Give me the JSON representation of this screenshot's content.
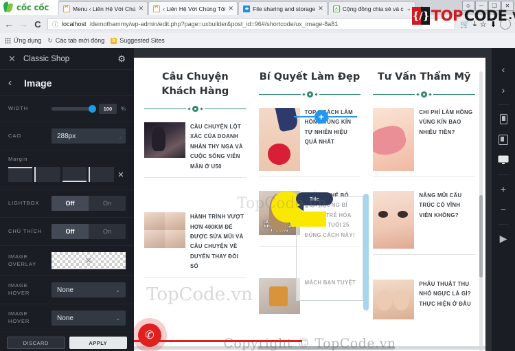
{
  "browser": {
    "brand": "cốc cốc",
    "tabs": [
      {
        "label": "Menu ‹ Liên Hệ Với Chú",
        "favicon": "wordpress-icon",
        "active": false
      },
      {
        "label": "‹ Liên Hệ Với Chúng Tôi",
        "favicon": "wordpress-icon",
        "active": true
      },
      {
        "label": "File sharing and storage",
        "favicon": "cloud-icon",
        "active": false
      },
      {
        "label": "Cộng đồng chia sẻ và c",
        "favicon": "community-icon",
        "active": false
      }
    ],
    "new_tab_label": "+",
    "window_controls": [
      "minimize",
      "restore",
      "maximize",
      "close"
    ],
    "nav": {
      "back": "←",
      "forward": "→",
      "reload": "C",
      "security_icon": "info-circle-icon",
      "url_host": "localhost",
      "url_path": "/demothammy/wp-admin/edit.php?page=uxbuilder&post_id=96#/shortcode/ux_image-8a81"
    },
    "bookmarks": [
      {
        "label": "Ứng dụng",
        "icon": "apps-grid-icon"
      },
      {
        "label": "Các tab mới đóng",
        "icon": "history-icon"
      },
      {
        "label": "Suggested Sites",
        "icon": "b-icon"
      }
    ]
  },
  "watermark": {
    "logo_top": "TOP",
    "logo_code": "CODE",
    "logo_vn": ".VN",
    "logo_glyph": "{/}",
    "copyright": "Copyright © TopCode.vn",
    "ghost_1": "TopCode.vn",
    "ghost_2": "TopCode.vn"
  },
  "sidebar": {
    "close_label": "✕",
    "title": "Classic Shop",
    "gear_label": "⚙",
    "back_label": "‹",
    "panel_name": "Image",
    "fields": {
      "width": {
        "label": "Width",
        "value": "100",
        "unit": "%",
        "slider_pct": 100
      },
      "height": {
        "label": "Cao",
        "value": "288px"
      },
      "margin": {
        "label": "Margin",
        "boxes": [
          "",
          "",
          "",
          ""
        ],
        "clear_label": "✕"
      },
      "lightbox": {
        "label": "Lightbox",
        "off": "Off",
        "on": "On",
        "selected": "Off"
      },
      "caption": {
        "label": "Chú thích",
        "off": "Off",
        "on": "On",
        "selected": "Off"
      },
      "image_overlay": {
        "label": "Image Overlay",
        "value": "none",
        "clear_glyph": "✕"
      },
      "image_hover": {
        "label": "Image Hover",
        "value": "None",
        "chevron": "⌄"
      },
      "image_hover_2": {
        "label": "Image Hover",
        "value": "None",
        "chevron": "⌄"
      }
    },
    "footer": {
      "discard": "DISCARD",
      "apply": "APPLY"
    }
  },
  "canvas": {
    "columns": [
      {
        "title": "Câu Chuyện Khách Hàng",
        "items": [
          {
            "thumb": "dark-audience-photo",
            "text": "CÂU CHUYỆN LỘT XÁC CỦA DOANH NHÂN THY NGA VÀ CUỘC SỐNG VIÊN MÃN Ở U50"
          },
          {
            "thumb": "nose-before-after-grid",
            "text": "HÀNH TRÌNH VƯỢT HƠN 400KM ĐỂ ĐƯỢC SỬA MŨI VÀ CÂU CHUYỆN VỀ DUYÊN THAY ĐỔI SỐ"
          }
        ]
      },
      {
        "title": "Bí Quyết Làm Đẹp",
        "items": [
          {
            "thumb": "red-bikini-photo",
            "text": "TOP 3 CÁCH LÀM HỒNG VÙNG KÍN TỰ NHIÊN HIỆU QUẢ NHẤT"
          },
          {
            "thumb": "long-hair-girl-photo",
            "text": "KHÔNG THỂ BỎ QUA NHỮNG BÍ QUYẾT TRẺ HÓA LÀN DA TUỔI 25 ĐÚNG CÁCH NÀY!",
            "overlay_caption": "LÀ LÀ HOA QUẢ NHỮNG CÔ GÁI THƯƠNG"
          },
          {
            "thumb": "handbag-photo",
            "text": "MÁCH BẠN TUYỆT"
          }
        ],
        "selected_element_badge": "Title",
        "add_button": "+"
      },
      {
        "title": "Tư Vấn Thẩm Mỹ",
        "items": [
          {
            "thumb": "pink-cloth-leg-photo",
            "text": "CHI PHÍ LÀM HỒNG VÙNG KÍN BAO NHIÊU TIỀN?"
          },
          {
            "thumb": "female-face-photo",
            "text": "NÂNG MŨI CẤU TRÚC CÓ VĨNH VIỄN KHÔNG?"
          },
          {
            "thumb": "bust-photo",
            "text": "PHẪU THUẬT THU NHỎ NGỰC LÀ GÌ? THỰC HIỆN Ở ĐÂU"
          }
        ]
      }
    ]
  },
  "right_toolbar": {
    "items": [
      {
        "name": "undo-icon",
        "glyph": "‹"
      },
      {
        "name": "redo-icon",
        "glyph": "›"
      },
      {
        "name": "mobile-view-icon",
        "glyph": "▯"
      },
      {
        "name": "tablet-view-icon",
        "glyph": "▢"
      },
      {
        "name": "desktop-view-icon",
        "glyph": "🖵"
      },
      {
        "name": "zoom-in-icon",
        "glyph": "+"
      },
      {
        "name": "zoom-out-icon",
        "glyph": "−"
      },
      {
        "name": "preview-play-icon",
        "glyph": "▶"
      }
    ]
  },
  "colors": {
    "accent_blue": "#2196f3",
    "sidebar_bg": "#1a1d23",
    "divider_green": "#2f8a6a",
    "brand_red": "#cf1a22",
    "highlight_yellow": "#fbe800"
  }
}
